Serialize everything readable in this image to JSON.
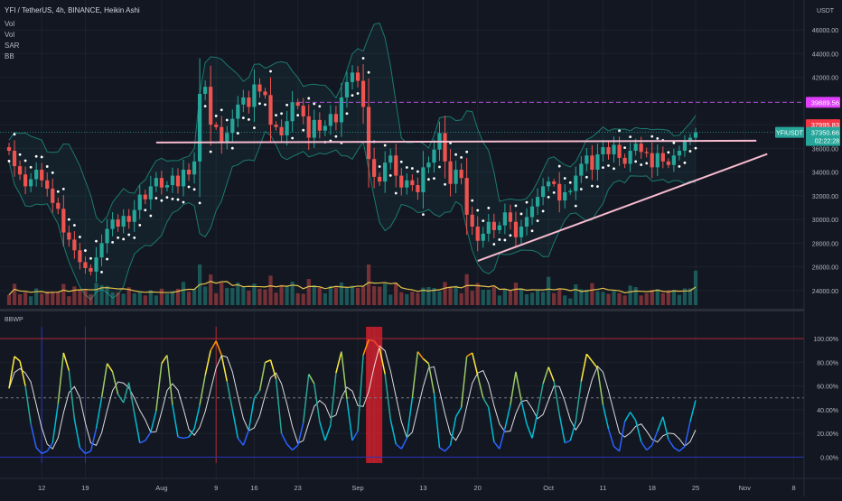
{
  "header": {
    "title": "YFI / TetherUS, 4h, BINANCE, Heikin Ashi",
    "indicators": [
      "Vol",
      "Vol",
      "SAR",
      "BB"
    ]
  },
  "price_axis": {
    "currency": "USDT",
    "ticks": [
      "46000.00",
      "44000.00",
      "42000.00",
      "40000.00",
      "38000.00",
      "36000.00",
      "34000.00",
      "32000.00",
      "30000.00",
      "28000.00",
      "26000.00",
      "24000.00"
    ]
  },
  "price_labels": {
    "target": {
      "text": "39889.56",
      "color": "#e040fb"
    },
    "high": {
      "text": "37995.83",
      "color": "#f23645"
    },
    "symbol": {
      "text": "YFIUSDT",
      "color": "#26a69a"
    },
    "last": {
      "text": "37350.66",
      "color": "#26a69a"
    },
    "countdown": {
      "text": "02:22:28",
      "color": "#26a69a"
    }
  },
  "lower_pane": {
    "title": "BBWP",
    "ticks": [
      "100.00%",
      "80.00%",
      "60.00%",
      "40.00%",
      "20.00%",
      "0.00%"
    ]
  },
  "time_axis": {
    "ticks": [
      "12",
      "19",
      "Aug",
      "9",
      "16",
      "23",
      "Sep",
      "13",
      "20",
      "Oct",
      "11",
      "18",
      "25",
      "Nov",
      "8"
    ]
  },
  "colors": {
    "background": "#131722",
    "up": "#26a69a",
    "down": "#ef5350",
    "trendline": "#f8bbd0",
    "bollinger": "#1b7a6e",
    "volume_ma": "#e6c34a",
    "target_line": "#b052d6"
  },
  "chart_data": [
    {
      "type": "candlestick",
      "name": "YFI / TetherUS, 4h, BINANCE, Heikin Ashi",
      "y_axis_range": [
        23000,
        47000
      ],
      "x_ticks": [
        "12",
        "19",
        "Aug",
        "9",
        "16",
        "23",
        "Sep",
        "13",
        "20",
        "Oct",
        "11",
        "18",
        "25",
        "Nov",
        "8"
      ],
      "x_tick_index": [
        6,
        14,
        28,
        38,
        45,
        53,
        64,
        76,
        86,
        99,
        109,
        118,
        126,
        135,
        144
      ],
      "price_close_path": [
        35800,
        34500,
        33800,
        32800,
        33400,
        34200,
        33300,
        32600,
        31400,
        30900,
        28900,
        28300,
        27400,
        26400,
        25900,
        25600,
        26800,
        28000,
        29200,
        30000,
        29400,
        30300,
        29800,
        30800,
        32100,
        31700,
        32800,
        33500,
        32700,
        32900,
        33700,
        32800,
        34200,
        33800,
        34900,
        40600,
        41200,
        38000,
        37800,
        36500,
        37300,
        38500,
        39700,
        40300,
        39500,
        41400,
        40800,
        40500,
        38000,
        37800,
        37100,
        38300,
        39900,
        39600,
        38700,
        36900,
        38400,
        37500,
        37900,
        38900,
        38200,
        40300,
        41600,
        42400,
        41700,
        39500,
        35100,
        33600,
        33200,
        34800,
        35400,
        33700,
        32700,
        33300,
        32900,
        32300,
        34400,
        34800,
        35900,
        37300,
        34900,
        33000,
        34200,
        33500,
        30400,
        29400,
        28200,
        28800,
        29800,
        29100,
        29500,
        30600,
        29800,
        28500,
        29400,
        30200,
        31100,
        31900,
        32800,
        33200,
        33000,
        31600,
        32300,
        32400,
        33700,
        34700,
        35400,
        34200,
        35500,
        36100,
        35500,
        36300,
        35200,
        34700,
        35800,
        36400,
        35700,
        35600,
        34400,
        35600,
        34900,
        34600,
        35400,
        35800,
        36600,
        36900,
        37351
      ],
      "trendlines": [
        {
          "label": "resistance",
          "from": [
            27,
            36500
          ],
          "to": [
            133,
            36650
          ]
        },
        {
          "label": "support",
          "from": [
            86,
            26500
          ],
          "to": [
            135,
            35300
          ]
        }
      ],
      "horizontal_levels": [
        {
          "value": 39889.56
        }
      ],
      "last_price": 37350.66,
      "high_marker": 37995.83
    },
    {
      "type": "line",
      "name": "BBWP",
      "y_axis_range": [
        -5,
        110
      ],
      "y_ticks": [
        0,
        20,
        40,
        60,
        80,
        100
      ],
      "reference_lines": [
        100,
        50,
        0
      ],
      "bbwp_path": [
        58,
        85,
        81,
        60,
        28,
        8,
        3,
        5,
        12,
        45,
        88,
        73,
        32,
        8,
        3,
        5,
        24,
        50,
        79,
        72,
        53,
        46,
        63,
        37,
        12,
        14,
        21,
        39,
        79,
        86,
        44,
        17,
        16,
        17,
        24,
        44,
        69,
        90,
        98,
        86,
        64,
        40,
        16,
        10,
        23,
        50,
        56,
        80,
        82,
        66,
        20,
        11,
        6,
        10,
        29,
        70,
        62,
        30,
        14,
        27,
        71,
        89,
        49,
        14,
        22,
        86,
        99,
        98,
        92,
        70,
        32,
        11,
        7,
        16,
        50,
        89,
        83,
        79,
        54,
        8,
        5,
        10,
        34,
        42,
        85,
        88,
        69,
        50,
        42,
        13,
        7,
        24,
        44,
        72,
        48,
        28,
        16,
        38,
        62,
        76,
        64,
        36,
        12,
        14,
        30,
        64,
        87,
        81,
        75,
        44,
        24,
        9,
        5,
        30,
        38,
        31,
        13,
        6,
        10,
        22,
        34,
        15,
        8,
        5,
        9,
        30,
        48
      ],
      "extreme_highlights": [
        {
          "from": 66,
          "to": 68
        }
      ]
    }
  ]
}
